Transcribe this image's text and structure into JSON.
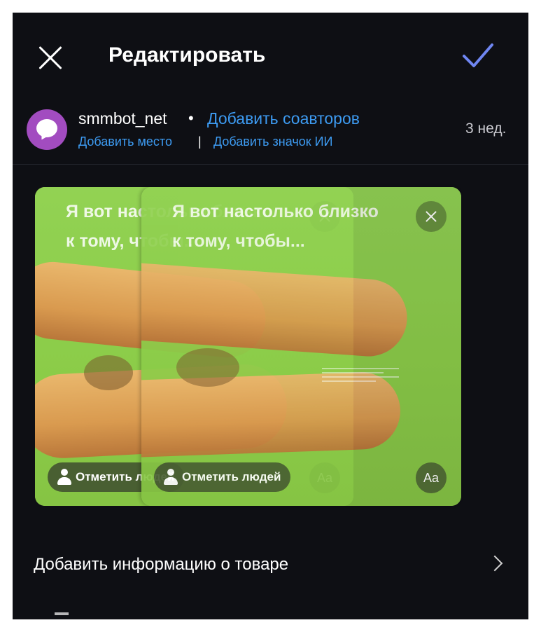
{
  "header": {
    "title": "Редактировать",
    "close_icon": "close-icon",
    "confirm_icon": "checkmark-icon",
    "accent_color": "#6f86f2"
  },
  "post_meta": {
    "username": "smmbot_net",
    "separator_dot": "•",
    "add_coauthors": "Добавить соавторов",
    "add_location": "Добавить место",
    "divider": "|",
    "add_ai_badge": "Добавить значок ИИ",
    "age": "3 нед.",
    "link_color": "#3d9bf2",
    "avatar_color": "#a24cc0"
  },
  "carousel": {
    "slides": [
      {
        "caption_line1": "Я вот настолько близко",
        "caption_line2": "к тому, чтобы...",
        "tag_people": "Отметить людей",
        "text_style_button": "Aa"
      },
      {
        "caption_line1": "Я вот настолько близко",
        "caption_line2": "к тому, чтобы...",
        "tag_people": "Отметить людей",
        "text_style_button": "Aa"
      }
    ],
    "slide_color": "#8fce4a"
  },
  "options": {
    "add_product_info": "Добавить информацию о товаре"
  }
}
